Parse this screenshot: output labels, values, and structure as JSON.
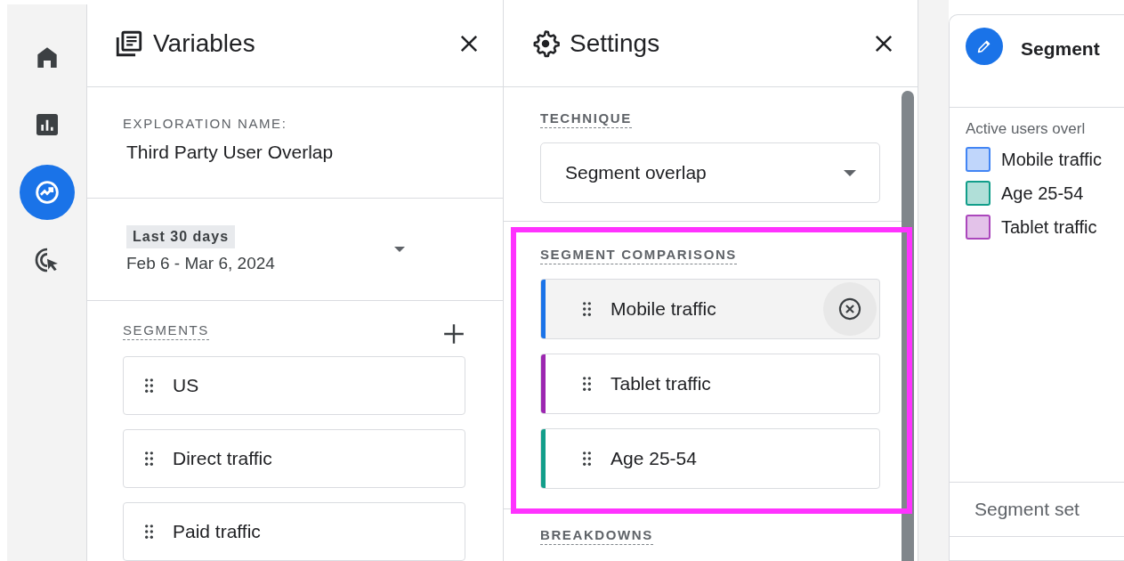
{
  "rail": {
    "items": [
      {
        "kind": "home",
        "selected": false
      },
      {
        "kind": "reports",
        "selected": false
      },
      {
        "kind": "explore",
        "selected": true
      },
      {
        "kind": "advertising",
        "selected": false
      }
    ]
  },
  "variables": {
    "title": "Variables",
    "exploration_label": "EXPLORATION NAME:",
    "exploration_name": "Third Party User Overlap",
    "date": {
      "badge": "Last 30 days",
      "range": "Feb 6 - Mar 6, 2024"
    },
    "segments_label": "SEGMENTS",
    "segments": [
      "US",
      "Direct traffic",
      "Paid traffic"
    ]
  },
  "settings": {
    "title": "Settings",
    "technique_label": "TECHNIQUE",
    "technique": "Segment overlap",
    "comparisons_label": "SEGMENT COMPARISONS",
    "comparisons": [
      {
        "name": "Mobile traffic",
        "color": "#1a73e8",
        "hovered": true
      },
      {
        "name": "Tablet traffic",
        "color": "#9c27b0",
        "hovered": false
      },
      {
        "name": "Age 25-54",
        "color": "#129e8a",
        "hovered": false
      }
    ],
    "breakdowns_label": "BREAKDOWNS"
  },
  "tab": {
    "title": "Segment",
    "legend_title": "Active users overl",
    "legend": [
      {
        "name": "Mobile traffic",
        "color": "#4285f4"
      },
      {
        "name": "Age 25-54",
        "color": "#129e8a"
      },
      {
        "name": "Tablet traffic",
        "color": "#ab47bc"
      }
    ],
    "footer": "Segment set"
  }
}
